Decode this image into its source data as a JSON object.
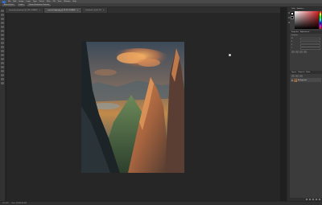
{
  "app": {
    "logo": "Ps"
  },
  "menu": [
    "File",
    "Edit",
    "Image",
    "Layer",
    "Type",
    "Select",
    "Filter",
    "3D",
    "View",
    "Window",
    "Help"
  ],
  "options": {
    "auto_select": "Auto-Select",
    "layer": "Layer",
    "show_transform": "Show Transform Controls"
  },
  "tabs": [
    {
      "label": "mountain-peak.psd @ 25% (RGB/8)",
      "active": false
    },
    {
      "label": "sunset-ridge.jpg @ 33.3% (RGB/8)",
      "active": true
    },
    {
      "label": "Untitled-1 @ 66.7%",
      "active": false
    }
  ],
  "status": {
    "zoom": "33.33%",
    "doc": "Doc: 24.5M/24.5M"
  },
  "panels": {
    "color_tabs": [
      "Color",
      "Swatches"
    ],
    "properties_tabs": [
      "Properties",
      "Adjustments"
    ],
    "properties": {
      "section": "Transform",
      "w_label": "W",
      "w_value": "",
      "h_label": "H",
      "h_value": "",
      "x_label": "X",
      "x_value": "",
      "y_label": "Y",
      "y_value": ""
    },
    "layers_tabs": [
      "Layers",
      "Channels",
      "Paths"
    ],
    "layers": [
      {
        "name": "Background"
      }
    ]
  },
  "colors": {
    "foreground": "#ffffff",
    "background": "#000000",
    "hue_selected": "#d21f26"
  }
}
